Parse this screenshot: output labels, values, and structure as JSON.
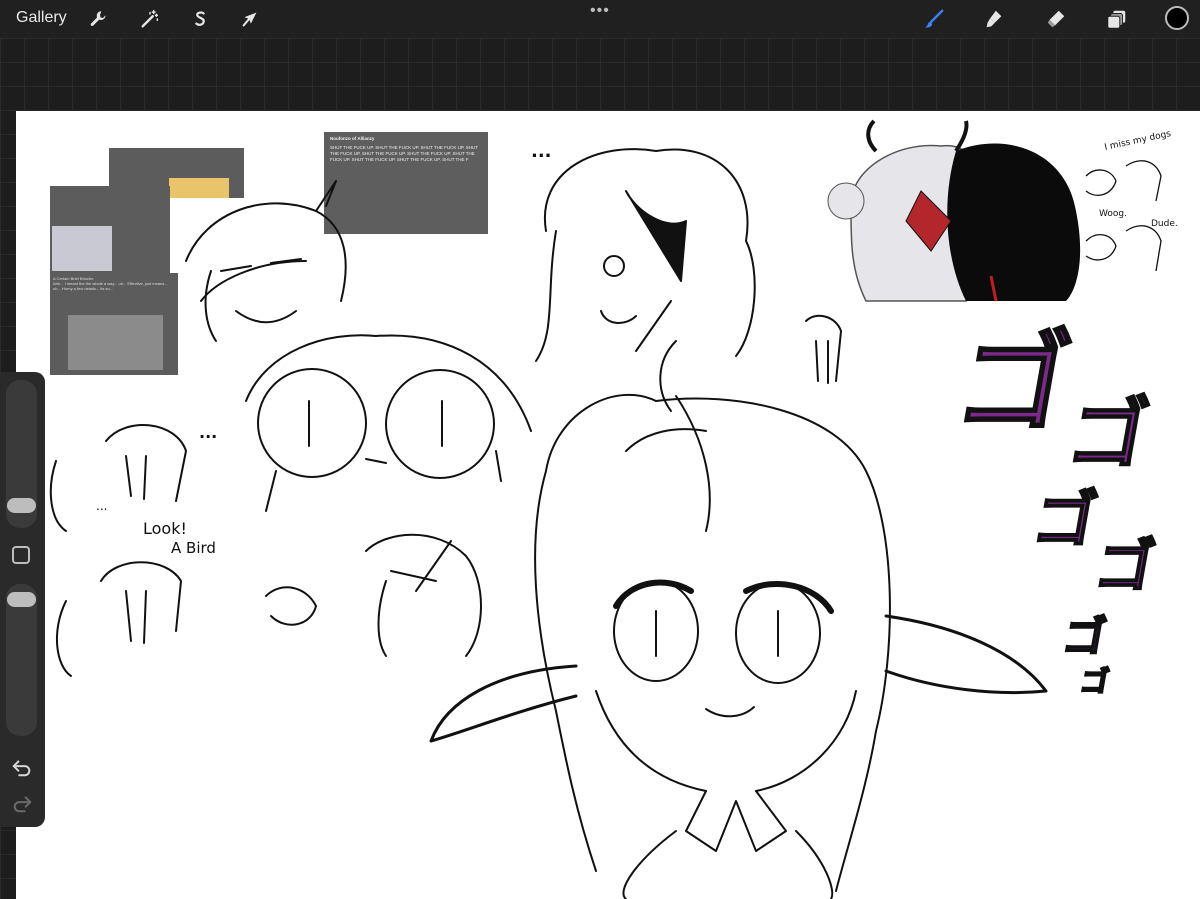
{
  "toolbar": {
    "gallery_label": "Gallery",
    "left_tools": [
      {
        "icon": "wrench-icon",
        "name": "actions"
      },
      {
        "icon": "magic-wand-icon",
        "name": "adjustments"
      },
      {
        "icon": "selection-s-icon",
        "name": "selection"
      },
      {
        "icon": "arrow-cursor-icon",
        "name": "transform"
      }
    ],
    "right_tools": [
      {
        "icon": "brush-icon",
        "name": "paint",
        "active": true
      },
      {
        "icon": "smudge-icon",
        "name": "smudge"
      },
      {
        "icon": "eraser-icon",
        "name": "erase"
      },
      {
        "icon": "layers-icon",
        "name": "layers"
      }
    ],
    "more_label": "•••",
    "current_color": "#000000",
    "accent": "#3b82f6"
  },
  "canvas": {
    "background": "#ffffff",
    "texts": {
      "look_label": "Look!",
      "bird_label": "A Bird",
      "ellipsis_1": "...",
      "ellipsis_2": "...",
      "ellipsis_3": "...",
      "miss_label": "I miss my dogs",
      "woog_label": "Woog.",
      "dude_label": "Dude."
    },
    "screenshots": {
      "tweet_big_name": "Noufonzo of Allianzy",
      "tweet_big_text": "SHUT THE FUCK UP. SHUT THE FUCK UP. SHUT THE FUCK UP. SHUT THE FUCK UP. SHUT THE FUCK UP. SHUT THE FUCK UP. SHUT THE FUCK UP. SHUT THE FUCK UP. SHUT THE FUCK UP. SHUT THE F",
      "tweet_card_title": "A Certain Brief Brioche",
      "tweet_card_text": "Ahh... I meant the the whole a way... uh... Effective, just means... uh... Horny a few details... its so..."
    },
    "menacing_color": "#7b2a8c"
  },
  "sidebar": {
    "undo_icon": "undo-icon",
    "redo_icon": "redo-icon",
    "modify_icon": "square-modify-icon"
  }
}
